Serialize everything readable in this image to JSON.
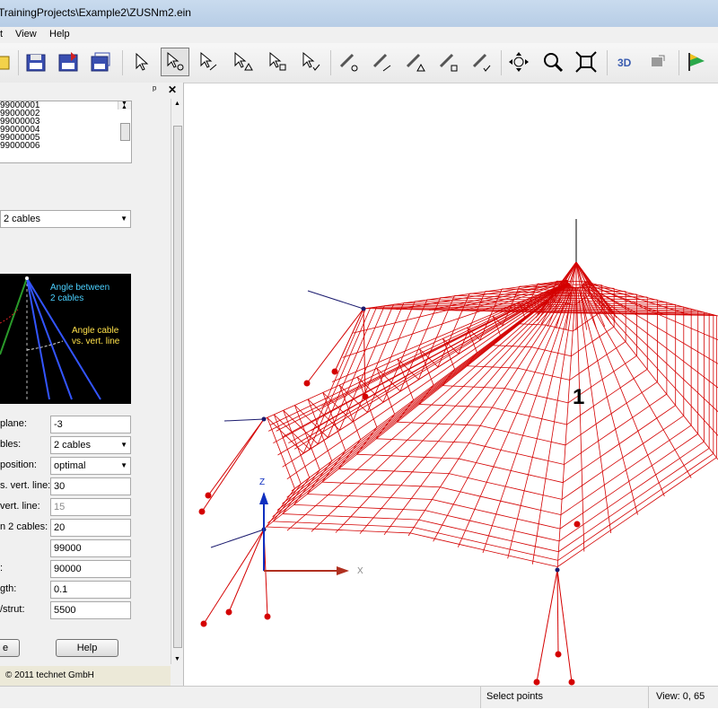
{
  "window": {
    "title": "TrainingProjects\\Example2\\ZUSNm2.ein"
  },
  "menu": {
    "items": [
      "t",
      "View",
      "Help"
    ]
  },
  "panel": {
    "pin_label": "ᵖ",
    "close_label": "✕",
    "list_items": [
      "99000001",
      "99000002",
      "99000003",
      "99000004",
      "99000005",
      "99000006"
    ],
    "type_select": "2 cables",
    "diagram": {
      "angle_between": "Angle between\n2 cables",
      "angle_vert": "Angle cable\nvs. vert. line"
    },
    "fields": [
      {
        "label": "plane:",
        "value": "-3"
      },
      {
        "label": "bles:",
        "value": "2 cables",
        "combo": true
      },
      {
        "label": "position:",
        "value": "optimal",
        "combo": true
      },
      {
        "label": "s. vert. line:",
        "value": "30"
      },
      {
        "label": "vert. line:",
        "value": "15",
        "disabled": true
      },
      {
        "label": "n 2 cables:",
        "value": "20"
      },
      {
        "label": "",
        "value": "99000"
      },
      {
        "label": ":",
        "value": "90000"
      },
      {
        "label": "gth:",
        "value": "0.1"
      },
      {
        "label": "/strut:",
        "value": "5500"
      }
    ],
    "ok_label": "e",
    "help_label": "Help",
    "copyright": "© 2011 technet GmbH"
  },
  "viewport": {
    "node_label": "1",
    "axis_z": "Z",
    "axis_x": "X"
  },
  "status": {
    "mode": "Select points",
    "view": "View: 0, 65"
  },
  "colors": {
    "mesh": "#d40000",
    "node": "#1a1a6e",
    "axis": "#1030c0"
  }
}
